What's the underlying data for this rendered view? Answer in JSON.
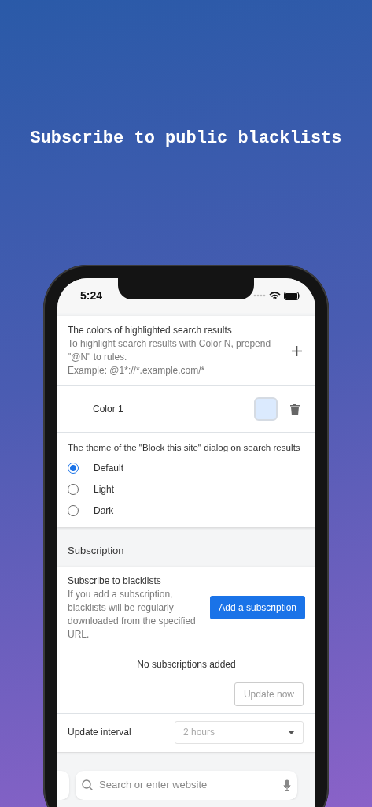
{
  "headline": "Subscribe to public blacklists",
  "status_bar": {
    "time": "5:24"
  },
  "highlight_colors": {
    "title": "The colors of highlighted search results",
    "description": [
      "To highlight search results with Color N, prepend \"@N\" to rules.",
      "Example: @1*://*.example.com/*"
    ],
    "colors": [
      {
        "label": "Color 1",
        "color": "#dbeafe"
      }
    ]
  },
  "dialog_theme": {
    "title": "The theme of the \"Block this site\" dialog on search results",
    "options": [
      {
        "label": "Default",
        "selected": true
      },
      {
        "label": "Light",
        "selected": false
      },
      {
        "label": "Dark",
        "selected": false
      }
    ]
  },
  "subscription": {
    "heading": "Subscription",
    "title": "Subscribe to blacklists",
    "description": "If you add a subscription, blacklists will be regularly downloaded from the specified URL.",
    "add_button": "Add a subscription",
    "empty_message": "No subscriptions added",
    "update_button": {
      "label": "Update now",
      "disabled": true
    },
    "interval_label": "Update interval",
    "interval_value": "2 hours"
  },
  "browser": {
    "search_placeholder": "Search or enter website"
  }
}
